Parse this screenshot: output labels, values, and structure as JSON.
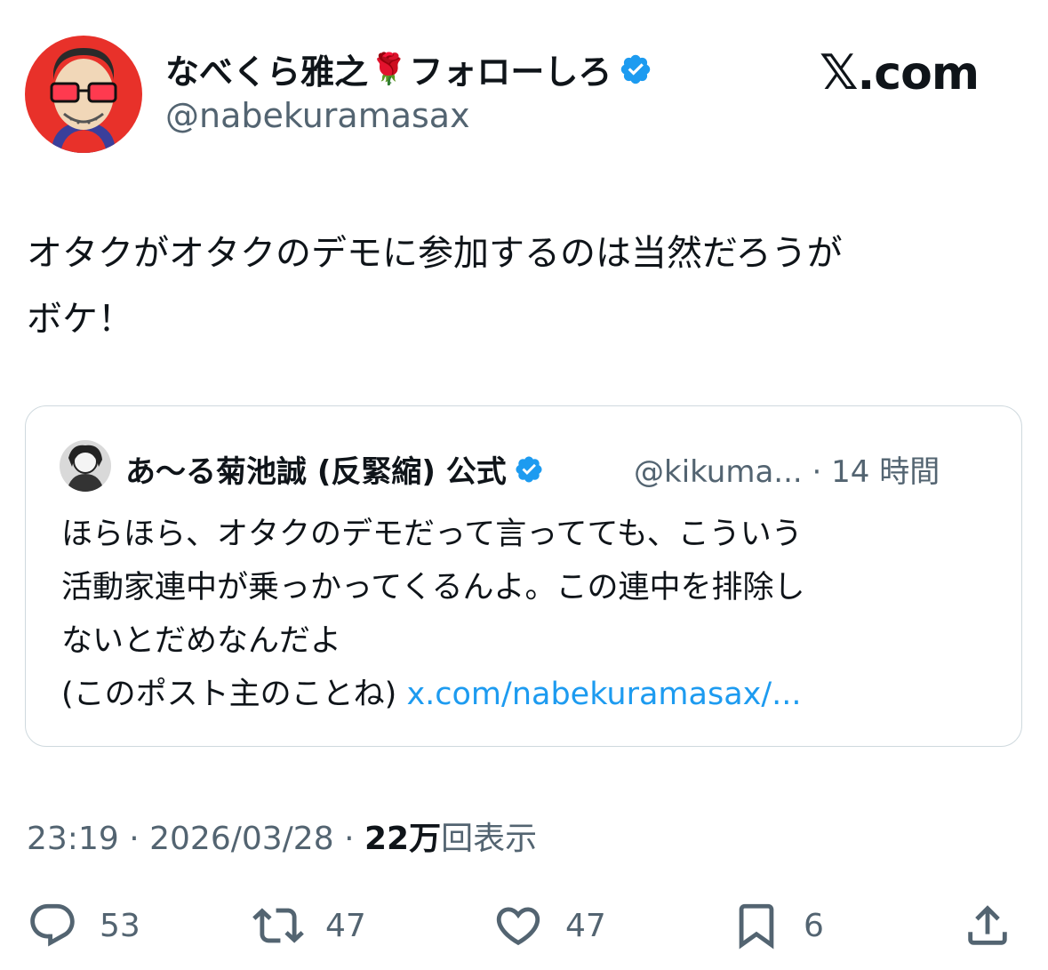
{
  "post": {
    "display_name": "なべくら雅之",
    "name_suffix": "フォローしろ",
    "name_emoji": "🌹",
    "handle": "@nabekuramasax",
    "brand": "X.com",
    "brand_x": "𝕏",
    "brand_rest": ".com",
    "text": "オタクがオタクのデモに参加するのは当然だろうが\nボケ！",
    "time": "23:19",
    "date": "2026/03/28",
    "views_count": "22",
    "views_unit": "万",
    "views_label": "回表示"
  },
  "quote": {
    "display_name": "あ〜る菊池誠 (反緊縮) 公式",
    "handle": "@kikuma...",
    "time_ago": "14 時間",
    "text": "ほらほら、オタクのデモだって言ってても、こういう\n活動家連中が乗っかってくるんよ。この連中を排除し\nないとだめなんだよ\n(このポスト主のことね) ",
    "link": "x.com/nabekuramasax/..."
  },
  "actions": {
    "reply_count": "53",
    "repost_count": "47",
    "like_count": "47",
    "bookmark_count": "6"
  },
  "colors": {
    "verified": "#1d9bf0",
    "secondary_text": "#536471",
    "link": "#1d9bf0",
    "avatar_bg": "#e8312a"
  },
  "icons": [
    "verified-badge-icon",
    "reply-icon",
    "repost-icon",
    "like-icon",
    "bookmark-icon",
    "share-icon"
  ]
}
